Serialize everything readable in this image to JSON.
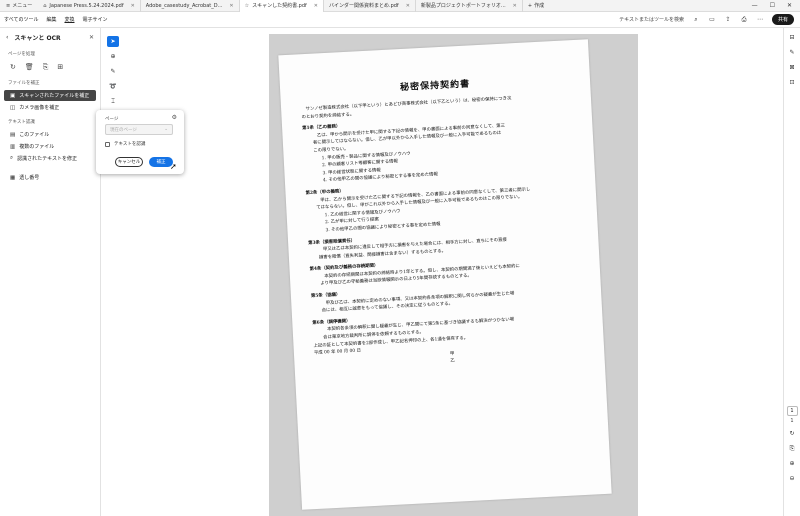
{
  "tabs": {
    "menu_label": "メニュー",
    "items": [
      {
        "label": "Japanese Press.5.24.2024.pdf",
        "active": false
      },
      {
        "label": "Adobe_casestudy_Acrobat_D...",
        "active": false
      },
      {
        "label": "スキャンした契約書.pdf",
        "active": true
      },
      {
        "label": "バインダー関係資料まとめ.pdf",
        "active": false
      },
      {
        "label": "新製品プロジェクトポートフォリオ...",
        "active": false
      }
    ],
    "new_tab_label": "作成"
  },
  "menubar": {
    "items": [
      "すべてのツール",
      "編集",
      "変換",
      "電子サイン"
    ],
    "search_placeholder": "テキストまたはツールを検索",
    "share_label": "共有"
  },
  "leftpanel": {
    "title": "スキャンと OCR",
    "section_page": "ページを処理",
    "section_file": "ファイルを補正",
    "scan_item": "スキャンされたファイルを補正",
    "camera_item": "カメラ画像を補正",
    "section_text": "テキスト認識",
    "this_file": "このファイル",
    "multi_file": "複数のファイル",
    "fix_text": "認識されたテキストを修正",
    "save_settings": "透し番号"
  },
  "popup": {
    "page_label": "ページ",
    "page_value": "現在のページ",
    "check_label": "テキストを認識",
    "cancel_label": "キャンセル",
    "apply_label": "補正"
  },
  "document": {
    "title": "秘密保持契約書",
    "lines": [
      {
        "t": "　サンノゼ製造株式会社（以下甲という）とあどび商事株式会社（以下乙という）は、秘密の保持につき次",
        "c": ""
      },
      {
        "t": "のとおり契約を締結する。",
        "c": ""
      },
      {
        "t": "第1条（乙の義務）",
        "c": "h"
      },
      {
        "t": "　乙は、甲から開示を受けた甲に関する下記の情報を、甲の書面による事前の同意なくして、第三",
        "c": "ind"
      },
      {
        "t": "者に開示してはならない。但し、乙が甲以外から入手した情報及び一般に入手可能であるものは",
        "c": "ind"
      },
      {
        "t": "この限りでない。",
        "c": "ind"
      },
      {
        "t": "1. 甲の販売・製品に関する情報及びノウハウ",
        "c": "ind2"
      },
      {
        "t": "2. 甲の顧客リスト等顧客に関する情報",
        "c": "ind2"
      },
      {
        "t": "3. 甲の経営状態に関する情報",
        "c": "ind2"
      },
      {
        "t": "4. その他甲乙の間の協議により秘密とする事を定めた情報",
        "c": "ind2"
      },
      {
        "t": "第2条（甲の義務）",
        "c": "h"
      },
      {
        "t": "　甲は、乙から開示を受けた乙に関する下記の情報を、乙の書面による事前の同意なくして、第三者に開示し",
        "c": "ind"
      },
      {
        "t": "てはならない。但し、甲がこれ以外から入手した情報及び一般に入手可能であるものはこの限りでない。",
        "c": "ind"
      },
      {
        "t": "1. 乙の経営に関する情報及びノウハウ",
        "c": "ind2"
      },
      {
        "t": "2. 乙が甲に対して行う提案",
        "c": "ind2"
      },
      {
        "t": "3. その他甲乙の間の協議により秘密とする事を定めた情報",
        "c": "ind2"
      },
      {
        "t": "第3条（損害賠償責任）",
        "c": "h"
      },
      {
        "t": "　甲又は乙は本契約に違反して相手方に損害を与えた場合には、相手方に対し、直ちにその直接",
        "c": "ind"
      },
      {
        "t": "損害を賠償（直失利益、間接損害は含まない）するものとする。",
        "c": "ind"
      },
      {
        "t": "第4条（契約及び義務の存続期間）",
        "c": "h"
      },
      {
        "t": "　本契約の存続期間は本契約の締結時より1年とする。但し、本契約の期間満了後といえども本契約に",
        "c": "ind"
      },
      {
        "t": "より甲及び乙の守秘義務は当該情報開示の日より5年間存続するものとする。",
        "c": "ind"
      },
      {
        "t": "第5条（協議）",
        "c": "h"
      },
      {
        "t": "　甲及び乙は、本契約に定めのない事項、又は本契約各条項の解釈に関し何らかの疑義が生じた場",
        "c": "ind"
      },
      {
        "t": "合には、相互に誠意をもって協議し、その決定に従うものとする。",
        "c": "ind"
      },
      {
        "t": "第6条（調停機関）",
        "c": "h"
      },
      {
        "t": "　本契約各条項の解釈に関し疑義が生じ、甲乙間にて第5条に基づき協議するも解決がつかない場",
        "c": "ind"
      },
      {
        "t": "合は東京地方裁判所に調停を依頼するものとする。",
        "c": "ind"
      },
      {
        "t": "",
        "c": ""
      },
      {
        "t": "上記の証として本契約書を2部作成し、甲乙記名押印の上、各1通を保有する。",
        "c": ""
      }
    ],
    "date": "平成 00 年 00 月 00 日",
    "party_a": "甲",
    "party_b": "乙"
  },
  "rightrail": {
    "page_current": "1",
    "page_total": "1"
  }
}
